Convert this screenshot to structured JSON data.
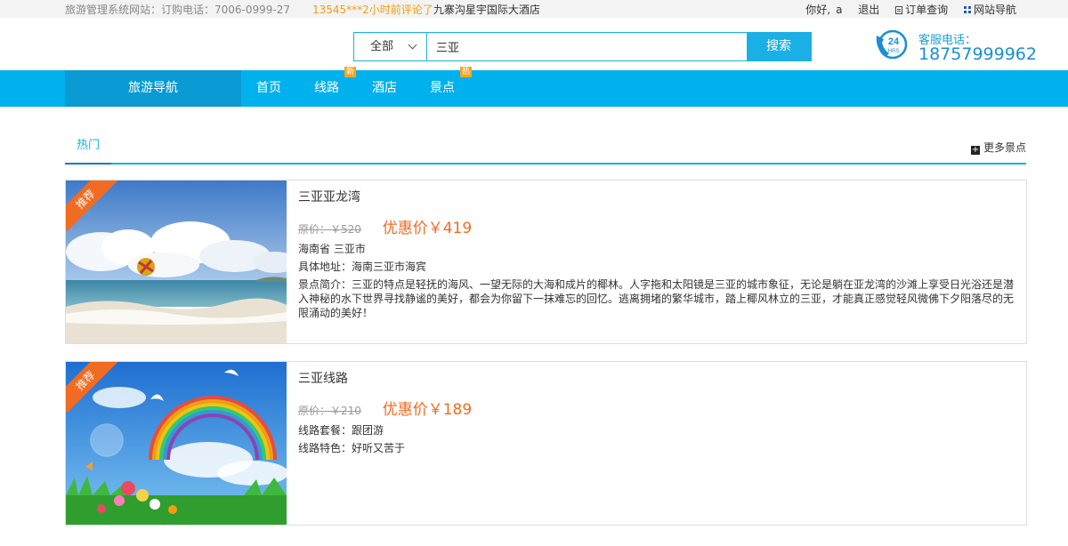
{
  "topbar": {
    "site_info": "旅游管理系统网站：订购电话：7006-0999-27",
    "review_highlight": "13545***2小时前评论了",
    "review_hotel": "九寨沟星宇国际大酒店",
    "greeting": "你好,",
    "username": "a",
    "logout": "退出",
    "order_query": "订单查询",
    "site_nav": "网站导航"
  },
  "search": {
    "category": "全部",
    "query": "三亚",
    "button": "搜索"
  },
  "service": {
    "badge_num": "24",
    "badge_text": "HRS",
    "label": "客服电话：",
    "phone": "18757999962"
  },
  "nav": {
    "guide": "旅游导航",
    "items": [
      {
        "label": "首页",
        "tag": ""
      },
      {
        "label": "线路",
        "tag": "新"
      },
      {
        "label": "酒店",
        "tag": ""
      },
      {
        "label": "景点",
        "tag": "热"
      }
    ]
  },
  "tabs": {
    "hot": "热门",
    "more": "更多景点"
  },
  "cards": [
    {
      "ribbon": "推荐",
      "title": "三亚亚龙湾",
      "orig_price": "原价：￥520",
      "sale_price": "优惠价￥419",
      "lines": [
        "海南省 三亚市",
        "具体地址：海南三亚市海宾"
      ],
      "desc": "景点简介：三亚的特点是轻抚的海风、一望无际的大海和成片的椰林。人字拖和太阳镜是三亚的城市象征，无论是躺在亚龙湾的沙滩上享受日光浴还是潜入神秘的水下世界寻找静谧的美好，都会为你留下一抹难忘的回忆。逃离拥堵的繁华城市，踏上椰风林立的三亚，才能真正感觉轻风微佛下夕阳落尽的无限涌动的美好！"
    },
    {
      "ribbon": "推荐",
      "title": "三亚线路",
      "orig_price": "原价：￥210",
      "sale_price": "优惠价￥189",
      "lines": [
        "线路套餐：跟团游",
        "线路特色：好听又苦于"
      ],
      "desc": ""
    }
  ],
  "colors": {
    "accent": "#00b1ed",
    "nav_dark": "#0a9ad4",
    "price": "#f26b22",
    "tag": "#f5a623"
  }
}
